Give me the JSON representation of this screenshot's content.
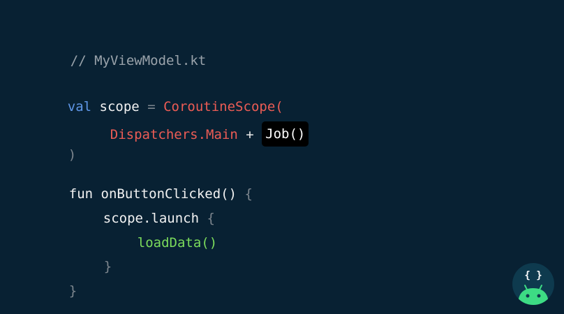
{
  "code": {
    "comment": "// MyViewModel.kt",
    "line1": {
      "kw": "val",
      "name": "scope",
      "eq": "=",
      "call": "CoroutineScope("
    },
    "line2": {
      "dispatcher": "Dispatchers.Main",
      "plus": "+",
      "job": "Job()"
    },
    "line3": {
      "close": ")"
    },
    "line4": {
      "kw": "fun",
      "name": "onButtonClicked()",
      "brace": "{"
    },
    "line5": {
      "call": "scope.launch",
      "brace": "{"
    },
    "line6": {
      "call": "loadData()"
    },
    "line7": {
      "brace": "}"
    },
    "line8": {
      "brace": "}"
    }
  },
  "logo": {
    "icon": "android-braces-icon",
    "glyph": "{ }",
    "colors": {
      "circle": "#0e3a4e",
      "android": "#3ddc84"
    }
  },
  "colors": {
    "background": "#082133",
    "keyword": "#5f97e8",
    "call": "#ec5c55",
    "green": "#7bdb5c",
    "comment": "#9aa3ab"
  }
}
